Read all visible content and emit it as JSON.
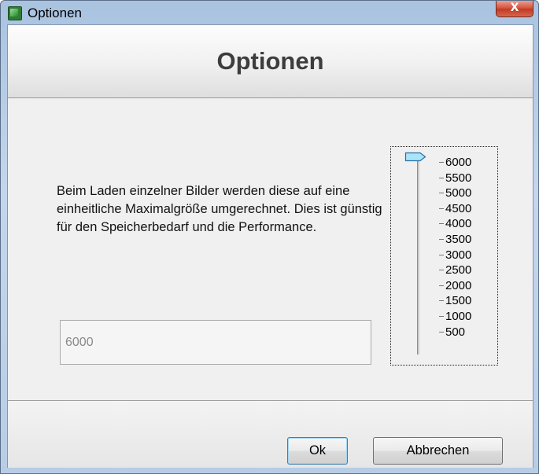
{
  "window": {
    "title": "Optionen",
    "close_label": "X"
  },
  "header": {
    "title": "Optionen"
  },
  "main": {
    "description": "Beim Laden einzelner Bilder werden diese auf eine einheitliche Maximalgröße umgerechnet. Dies ist günstig für den Speicherbedarf und die Performance.",
    "value_field": "6000",
    "slider": {
      "value": 6000,
      "min": 500,
      "max": 6000,
      "ticks": [
        "6000",
        "5500",
        "5000",
        "4500",
        "4000",
        "3500",
        "3000",
        "2500",
        "2000",
        "1500",
        "1000",
        "500"
      ]
    }
  },
  "footer": {
    "ok_label": "Ok",
    "cancel_label": "Abbrechen"
  },
  "colors": {
    "thumb_fill": "#a9e4f7",
    "thumb_stroke": "#2b6ea8",
    "ok_focus": "#3c7fb1",
    "close_red": "#c13b25"
  }
}
